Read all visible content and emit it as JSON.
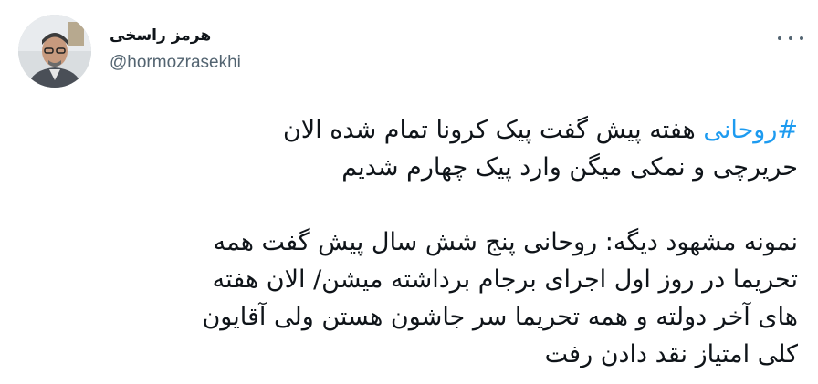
{
  "author": {
    "display_name": "هرمز راسخی",
    "handle": "@hormozrasekhi"
  },
  "tweet": {
    "hashtag": "#روحانی",
    "line1_rest": " هفته پیش گفت پیک کرونا تمام شده الان",
    "line2": "حریرچی و نمکی میگن وارد پیک چهارم شدیم",
    "line3": "نمونه مشهود دیگه: روحانی پنج شش سال پیش گفت همه",
    "line4": "تحریما در روز اول اجرای برجام برداشته میشن/ الان هفته",
    "line5": "های آخر دولته و همه تحریما سر جاشون هستن ولی آقایون",
    "line6": "کلی امتیاز نقد دادن رفت"
  },
  "colors": {
    "hashtag": "#1d9bf0",
    "text": "#0f1419",
    "secondary": "#536471"
  },
  "icons": {
    "more": "more-horizontal-icon",
    "avatar": "avatar-photo"
  }
}
